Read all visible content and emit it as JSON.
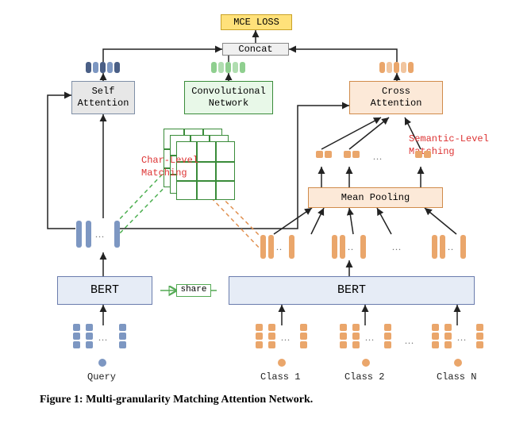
{
  "blocks": {
    "mce": "MCE LOSS",
    "concat": "Concat",
    "self_attention": "Self\nAttention",
    "conv_net": "Convolutional\nNetwork",
    "cross_attention": "Cross\nAttention",
    "mean_pooling": "Mean Pooling",
    "bert_left": "BERT",
    "bert_right": "BERT",
    "share": "share"
  },
  "annotations": {
    "char_level": "Char-Level\nMatching",
    "semantic_level": "Semantic-Level\nMatching"
  },
  "inputs": {
    "query": "Query",
    "class1": "Class 1",
    "class2": "Class 2",
    "classN": "Class N"
  },
  "caption": "Figure 1: Multi-granularity Matching Attention Network.",
  "colors": {
    "blue": "#7d97c2",
    "darkblue": "#4a5f86",
    "orange": "#eaa66b",
    "green": "#8fcf8f",
    "red": "#d33",
    "yellow": "#ffe17a"
  },
  "diagram": {
    "description": "Query tokens encoded by BERT feed Self-Attention and Convolutional Network (char-level matching). Class-description tokens encoded by shared BERT are Mean-Pooled to class vectors; Cross-Attention between query and class vectors yields semantic-level matching. Outputs concatenated and fed to MCE loss.",
    "modules": [
      "BERT (shared)",
      "Self Attention",
      "Convolutional Network",
      "Mean Pooling",
      "Cross Attention",
      "Concat",
      "MCE Loss"
    ],
    "matching_levels": [
      "Char-Level Matching",
      "Semantic-Level Matching"
    ]
  }
}
